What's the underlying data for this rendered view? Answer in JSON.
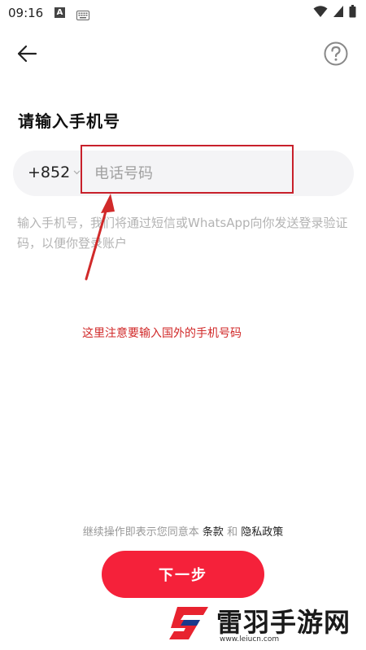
{
  "status_bar": {
    "time": "09:16",
    "notification_letter": "A"
  },
  "header": {
    "back_icon": "arrow-left-icon",
    "help_icon": "question-circle-icon"
  },
  "page": {
    "title": "请输入手机号"
  },
  "phone_input": {
    "country_code": "+852",
    "placeholder": "电话号码",
    "value": ""
  },
  "hint": "输入手机号，我们将通过短信或WhatsApp向你发送登录验证码，以便你登录账户",
  "annotation": {
    "text": "这里注意要输入国外的手机号码",
    "color": "#d12a2a"
  },
  "terms": {
    "prefix": "继续操作即表示您同意本",
    "terms_link": "条款",
    "and": "和",
    "privacy_link": "隐私政策"
  },
  "next_button": {
    "label": "下一步",
    "color": "#f5213a"
  },
  "watermark": {
    "name": "雷羽手游网",
    "url": "www.leiucn.com"
  }
}
